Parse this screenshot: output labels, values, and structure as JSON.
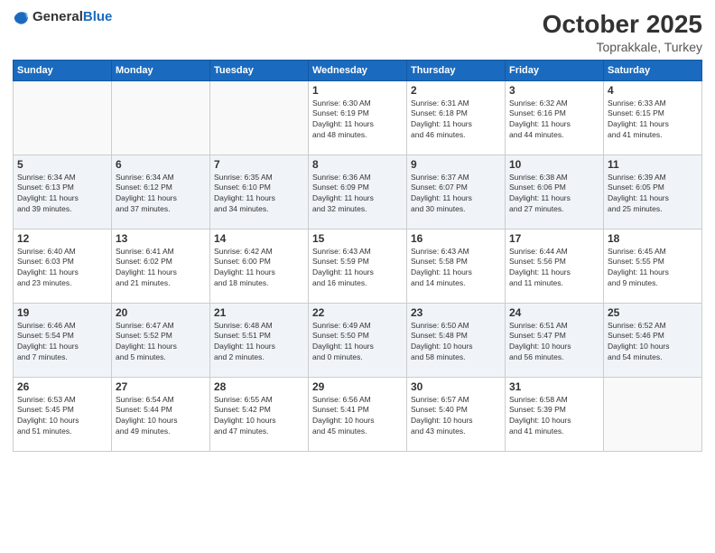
{
  "header": {
    "logo_general": "General",
    "logo_blue": "Blue",
    "month": "October 2025",
    "location": "Toprakkale, Turkey"
  },
  "weekdays": [
    "Sunday",
    "Monday",
    "Tuesday",
    "Wednesday",
    "Thursday",
    "Friday",
    "Saturday"
  ],
  "weeks": [
    [
      {
        "day": "",
        "info": ""
      },
      {
        "day": "",
        "info": ""
      },
      {
        "day": "",
        "info": ""
      },
      {
        "day": "1",
        "info": "Sunrise: 6:30 AM\nSunset: 6:19 PM\nDaylight: 11 hours\nand 48 minutes."
      },
      {
        "day": "2",
        "info": "Sunrise: 6:31 AM\nSunset: 6:18 PM\nDaylight: 11 hours\nand 46 minutes."
      },
      {
        "day": "3",
        "info": "Sunrise: 6:32 AM\nSunset: 6:16 PM\nDaylight: 11 hours\nand 44 minutes."
      },
      {
        "day": "4",
        "info": "Sunrise: 6:33 AM\nSunset: 6:15 PM\nDaylight: 11 hours\nand 41 minutes."
      }
    ],
    [
      {
        "day": "5",
        "info": "Sunrise: 6:34 AM\nSunset: 6:13 PM\nDaylight: 11 hours\nand 39 minutes."
      },
      {
        "day": "6",
        "info": "Sunrise: 6:34 AM\nSunset: 6:12 PM\nDaylight: 11 hours\nand 37 minutes."
      },
      {
        "day": "7",
        "info": "Sunrise: 6:35 AM\nSunset: 6:10 PM\nDaylight: 11 hours\nand 34 minutes."
      },
      {
        "day": "8",
        "info": "Sunrise: 6:36 AM\nSunset: 6:09 PM\nDaylight: 11 hours\nand 32 minutes."
      },
      {
        "day": "9",
        "info": "Sunrise: 6:37 AM\nSunset: 6:07 PM\nDaylight: 11 hours\nand 30 minutes."
      },
      {
        "day": "10",
        "info": "Sunrise: 6:38 AM\nSunset: 6:06 PM\nDaylight: 11 hours\nand 27 minutes."
      },
      {
        "day": "11",
        "info": "Sunrise: 6:39 AM\nSunset: 6:05 PM\nDaylight: 11 hours\nand 25 minutes."
      }
    ],
    [
      {
        "day": "12",
        "info": "Sunrise: 6:40 AM\nSunset: 6:03 PM\nDaylight: 11 hours\nand 23 minutes."
      },
      {
        "day": "13",
        "info": "Sunrise: 6:41 AM\nSunset: 6:02 PM\nDaylight: 11 hours\nand 21 minutes."
      },
      {
        "day": "14",
        "info": "Sunrise: 6:42 AM\nSunset: 6:00 PM\nDaylight: 11 hours\nand 18 minutes."
      },
      {
        "day": "15",
        "info": "Sunrise: 6:43 AM\nSunset: 5:59 PM\nDaylight: 11 hours\nand 16 minutes."
      },
      {
        "day": "16",
        "info": "Sunrise: 6:43 AM\nSunset: 5:58 PM\nDaylight: 11 hours\nand 14 minutes."
      },
      {
        "day": "17",
        "info": "Sunrise: 6:44 AM\nSunset: 5:56 PM\nDaylight: 11 hours\nand 11 minutes."
      },
      {
        "day": "18",
        "info": "Sunrise: 6:45 AM\nSunset: 5:55 PM\nDaylight: 11 hours\nand 9 minutes."
      }
    ],
    [
      {
        "day": "19",
        "info": "Sunrise: 6:46 AM\nSunset: 5:54 PM\nDaylight: 11 hours\nand 7 minutes."
      },
      {
        "day": "20",
        "info": "Sunrise: 6:47 AM\nSunset: 5:52 PM\nDaylight: 11 hours\nand 5 minutes."
      },
      {
        "day": "21",
        "info": "Sunrise: 6:48 AM\nSunset: 5:51 PM\nDaylight: 11 hours\nand 2 minutes."
      },
      {
        "day": "22",
        "info": "Sunrise: 6:49 AM\nSunset: 5:50 PM\nDaylight: 11 hours\nand 0 minutes."
      },
      {
        "day": "23",
        "info": "Sunrise: 6:50 AM\nSunset: 5:48 PM\nDaylight: 10 hours\nand 58 minutes."
      },
      {
        "day": "24",
        "info": "Sunrise: 6:51 AM\nSunset: 5:47 PM\nDaylight: 10 hours\nand 56 minutes."
      },
      {
        "day": "25",
        "info": "Sunrise: 6:52 AM\nSunset: 5:46 PM\nDaylight: 10 hours\nand 54 minutes."
      }
    ],
    [
      {
        "day": "26",
        "info": "Sunrise: 6:53 AM\nSunset: 5:45 PM\nDaylight: 10 hours\nand 51 minutes."
      },
      {
        "day": "27",
        "info": "Sunrise: 6:54 AM\nSunset: 5:44 PM\nDaylight: 10 hours\nand 49 minutes."
      },
      {
        "day": "28",
        "info": "Sunrise: 6:55 AM\nSunset: 5:42 PM\nDaylight: 10 hours\nand 47 minutes."
      },
      {
        "day": "29",
        "info": "Sunrise: 6:56 AM\nSunset: 5:41 PM\nDaylight: 10 hours\nand 45 minutes."
      },
      {
        "day": "30",
        "info": "Sunrise: 6:57 AM\nSunset: 5:40 PM\nDaylight: 10 hours\nand 43 minutes."
      },
      {
        "day": "31",
        "info": "Sunrise: 6:58 AM\nSunset: 5:39 PM\nDaylight: 10 hours\nand 41 minutes."
      },
      {
        "day": "",
        "info": ""
      }
    ]
  ]
}
